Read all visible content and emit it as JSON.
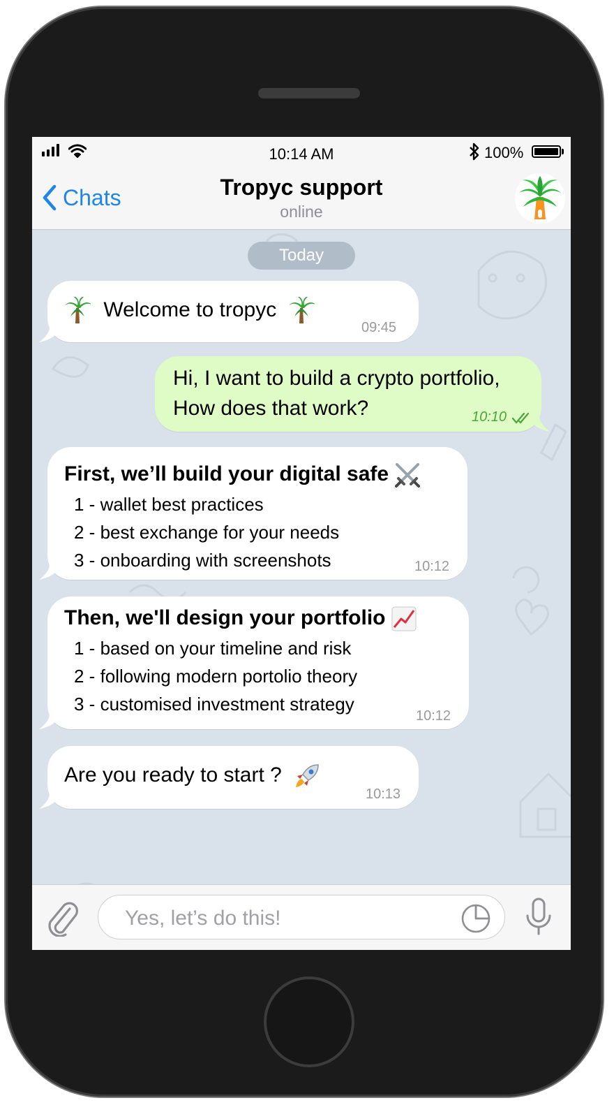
{
  "statusbar": {
    "time": "10:14 AM",
    "battery": "100%"
  },
  "header": {
    "back_label": "Chats",
    "title": "Tropyc support",
    "status": "online"
  },
  "date_separator": "Today",
  "messages": [
    {
      "direction": "in",
      "text": "Welcome to tropyc",
      "time": "09:45"
    },
    {
      "direction": "out",
      "lines": [
        "Hi, I want to build a crypto portfolio,",
        "How does that work?"
      ],
      "time": "10:10"
    },
    {
      "direction": "in",
      "heading": "First, we’ll build your digital safe",
      "items": [
        "1 - wallet best practices",
        "2 - best exchange for your needs",
        "3 - onboarding with screenshots"
      ],
      "time": "10:12"
    },
    {
      "direction": "in",
      "heading": "Then, we'll design your portfolio",
      "items": [
        "1 - based on your timeline and risk",
        "2 - following modern portolio theory",
        "3 - customised investment strategy"
      ],
      "time": "10:12"
    },
    {
      "direction": "in",
      "text": "Are you ready to start ?",
      "time": "10:13"
    }
  ],
  "composer": {
    "placeholder": "Yes, let’s do this!"
  },
  "colors": {
    "accent": "#1f86e8",
    "outgoing_bubble": "#e0fcc6",
    "read_check": "#4aa638",
    "wallpaper": "#d9e2ea"
  },
  "icons": [
    "signal-icon",
    "wifi-icon",
    "bluetooth-icon",
    "battery-icon",
    "back-chevron-icon",
    "palm-tree-avatar",
    "palm-tree-emoji",
    "crossed-swords-emoji",
    "chart-increasing-emoji",
    "rocket-emoji",
    "double-check-icon",
    "paperclip-icon",
    "sticker-icon",
    "microphone-icon"
  ]
}
